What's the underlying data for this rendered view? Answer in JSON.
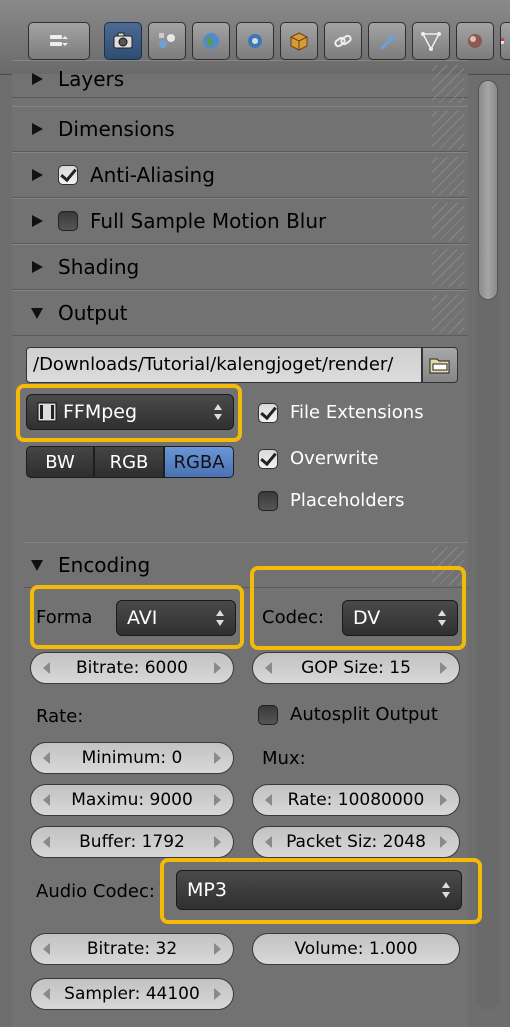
{
  "header": {
    "tabs": [
      "editor-type-icon",
      "render-icon",
      "render-layers-icon",
      "scene-icon",
      "world-icon",
      "object-icon",
      "constraints-icon",
      "modifier-icon",
      "data-icon",
      "material-icon",
      "texture-icon"
    ]
  },
  "sections": {
    "layers": "Layers",
    "dimensions": "Dimensions",
    "anti_aliasing": "Anti-Aliasing",
    "motion_blur": "Full Sample Motion Blur",
    "shading": "Shading",
    "output": "Output",
    "encoding": "Encoding"
  },
  "output": {
    "path": "/Downloads/Tutorial/kalengjoget/render/",
    "format": "FFMpeg",
    "color_modes": [
      "BW",
      "RGB",
      "RGBA"
    ],
    "active_color_mode": "RGBA",
    "file_extensions": "File Extensions",
    "overwrite": "Overwrite",
    "placeholders": "Placeholders"
  },
  "encoding": {
    "format_label": "Forma",
    "format_value": "AVI",
    "codec_label": "Codec:",
    "codec_value": "DV",
    "bitrate": "Bitrate: 6000",
    "gop_size": "GOP Size: 15",
    "rate_label": "Rate:",
    "autosplit": "Autosplit Output",
    "minimum": "Minimum: 0",
    "mux_label": "Mux:",
    "maximum": "Maximu: 9000",
    "mux_rate": "Rate: 10080000",
    "buffer": "Buffer: 1792",
    "packet_size": "Packet Siz: 2048",
    "audio_codec_label": "Audio Codec:",
    "audio_codec_value": "MP3",
    "audio_bitrate": "Bitrate: 32",
    "volume": "Volume: 1.000",
    "sampler": "Sampler: 44100"
  },
  "colors": {
    "highlight": "#f5b90a",
    "active_blue": "#5a82c4"
  }
}
